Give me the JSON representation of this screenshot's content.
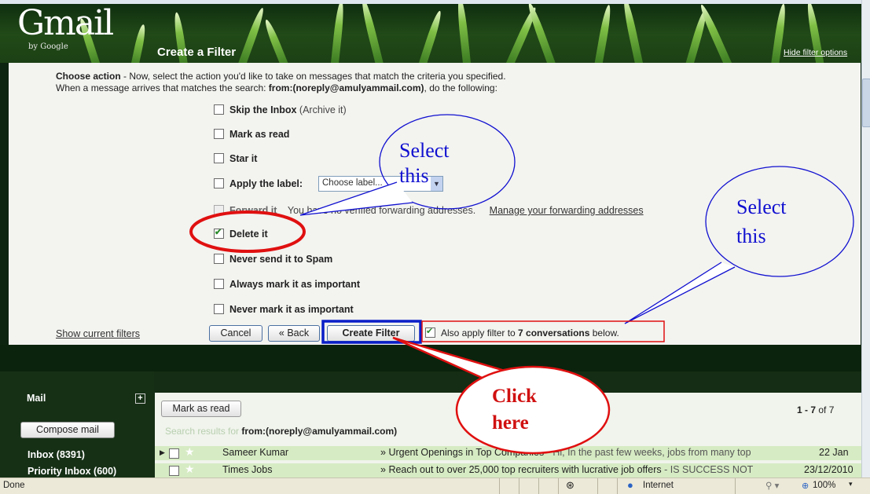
{
  "header": {
    "logo": "Gmail",
    "logo_sub": "by Google",
    "title": "Create a Filter",
    "hide_link": "Hide filter options"
  },
  "filter": {
    "intro_bold": "Choose action",
    "intro_rest": " - Now, select the action you'd like to take on messages that match the criteria you specified.",
    "line2_pre": "When a message arrives that matches the search: ",
    "line2_query": "from:(noreply@amulyammail.com)",
    "line2_post": ", do the following:",
    "options": {
      "skip_inbox": "Skip the Inbox",
      "skip_inbox_note": "(Archive it)",
      "mark_read": "Mark as read",
      "star": "Star it",
      "apply_label": "Apply the label:",
      "label_select": "Choose label...",
      "forward": "Forward it",
      "forward_note": "You have no verified forwarding addresses.",
      "manage_forwarding": "Manage your forwarding addresses",
      "delete": "Delete it",
      "never_spam": "Never send it to Spam",
      "always_important": "Always mark it as important",
      "never_important": "Never mark it as important"
    },
    "show_filters": "Show current filters",
    "cancel": "Cancel",
    "back": "« Back",
    "create": "Create Filter",
    "also_apply_pre": "Also apply filter to ",
    "also_apply_bold": "7 conversations",
    "also_apply_post": " below."
  },
  "sidebar": {
    "mail": "Mail",
    "plus": "+",
    "compose": "Compose mail",
    "inbox": "Inbox (8391)",
    "priority": "Priority Inbox (600)"
  },
  "list": {
    "mark_read": "Mark as read",
    "count_bold": "1 - 7",
    "count_rest": " of 7",
    "search_pre": "Search results for ",
    "search_query": "from:(noreply@amulyammail.com)",
    "rows": [
      {
        "sender": "Sameer Kumar",
        "subject": "Urgent Openings in Top Companies",
        "snippet": " - Hi, In the past few weeks, jobs from many top",
        "date": "22 Jan"
      },
      {
        "sender": "Times Jobs",
        "subject": "Reach out to over 25,000 top recruiters with lucrative job offers",
        "snippet": " - IS SUCCESS NOT",
        "date": "23/12/2010"
      }
    ]
  },
  "annotations": {
    "bubble1": [
      "Select",
      "this"
    ],
    "bubble2": [
      "Select",
      "this"
    ],
    "click": [
      "Click",
      "here"
    ]
  },
  "status": {
    "done": "Done",
    "zone": "Internet",
    "zoom": "100%"
  },
  "colors": {
    "annotation_blue": "#1010d0",
    "annotation_red": "#e01010",
    "row_green": "#d6ebc3"
  }
}
